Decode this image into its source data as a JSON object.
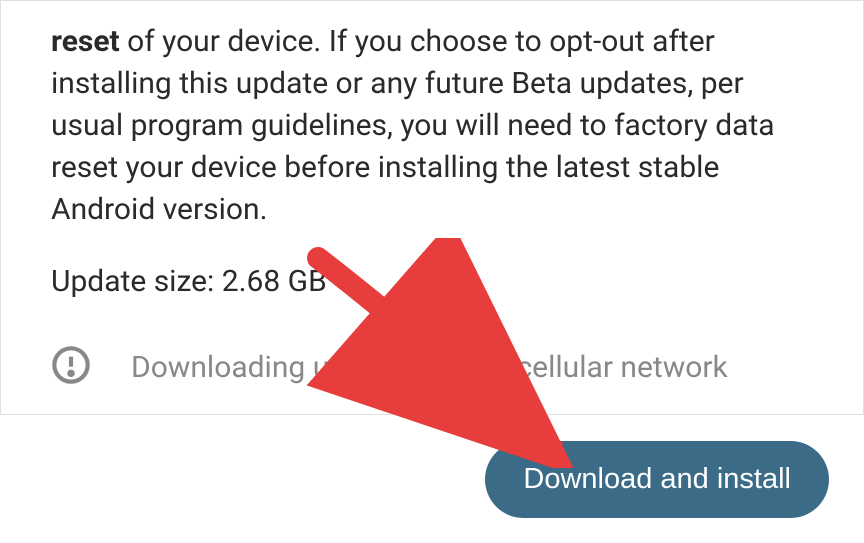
{
  "description": {
    "bold_prefix": "reset",
    "text": " of your device. If you choose to opt-out after installing this update or any future Beta updates, per usual program guidelines, you will need to factory data reset your device before installing the latest stable Android version."
  },
  "update_size": {
    "label": "Update size: ",
    "value": "2.68 GB"
  },
  "warning": {
    "text": "Downloading updates over a cellular network"
  },
  "button": {
    "label": "Download and install"
  }
}
